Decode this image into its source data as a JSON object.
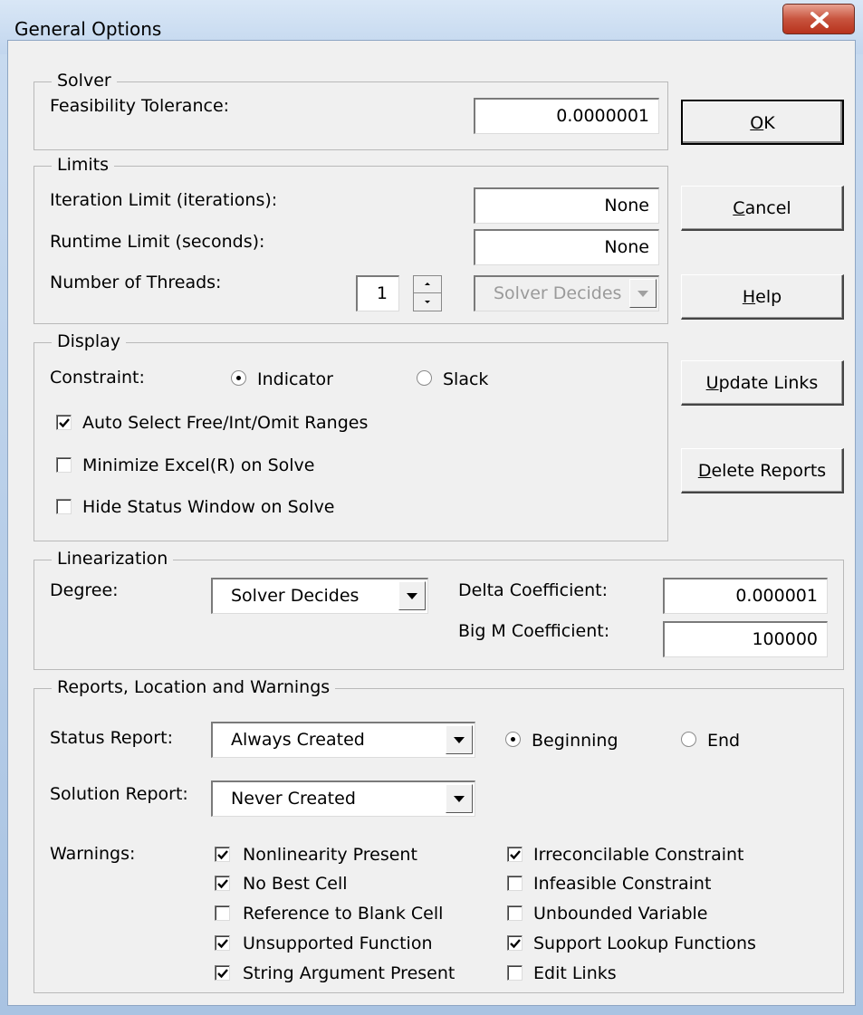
{
  "window": {
    "title": "General Options",
    "close_icon": "close-icon"
  },
  "solver": {
    "group_title": "Solver",
    "feasibility_label": "Feasibility Tolerance:",
    "feasibility_value": "0.0000001"
  },
  "limits": {
    "group_title": "Limits",
    "iteration_label": "Iteration Limit (iterations):",
    "iteration_value": "None",
    "runtime_label": "Runtime Limit (seconds):",
    "runtime_value": "None",
    "threads_label": "Number of Threads:",
    "threads_value": "1",
    "threads_mode": "Solver Decides"
  },
  "display": {
    "group_title": "Display",
    "constraint_label": "Constraint:",
    "radio_indicator": "Indicator",
    "radio_slack": "Slack",
    "selected": "Indicator",
    "checks": [
      {
        "label": "Auto Select Free/Int/Omit Ranges",
        "checked": true
      },
      {
        "label": "Minimize Excel(R) on Solve",
        "checked": false
      },
      {
        "label": "Hide Status Window on Solve",
        "checked": false
      }
    ]
  },
  "linearization": {
    "group_title": "Linearization",
    "degree_label": "Degree:",
    "degree_value": "Solver Decides",
    "delta_label": "Delta Coefficient:",
    "delta_value": "0.000001",
    "bigm_label": "Big M Coefficient:",
    "bigm_value": "100000"
  },
  "reports": {
    "group_title": "Reports, Location and Warnings",
    "status_label": "Status Report:",
    "status_value": "Always Created",
    "radio_beginning": "Beginning",
    "radio_end": "End",
    "selected": "Beginning",
    "solution_label": "Solution Report:",
    "solution_value": "Never Created",
    "warnings_label": "Warnings:",
    "warnings_left": [
      {
        "label": "Nonlinearity Present",
        "checked": true
      },
      {
        "label": "No Best Cell",
        "checked": true
      },
      {
        "label": "Reference to Blank Cell",
        "checked": false
      },
      {
        "label": "Unsupported Function",
        "checked": true
      },
      {
        "label": "String Argument Present",
        "checked": true
      }
    ],
    "warnings_right": [
      {
        "label": "Irreconcilable Constraint",
        "checked": true
      },
      {
        "label": "Infeasible Constraint",
        "checked": false
      },
      {
        "label": "Unbounded Variable",
        "checked": false
      },
      {
        "label": "Support Lookup Functions",
        "checked": true
      },
      {
        "label": "Edit Links",
        "checked": false
      }
    ]
  },
  "buttons": {
    "ok": {
      "first": "O",
      "rest": "K"
    },
    "cancel": {
      "first": "C",
      "rest": "ancel"
    },
    "help": {
      "first": "H",
      "rest": "elp"
    },
    "update": {
      "first": "U",
      "rest": "pdate Links"
    },
    "delete": {
      "first": "D",
      "rest": "elete Reports"
    }
  }
}
